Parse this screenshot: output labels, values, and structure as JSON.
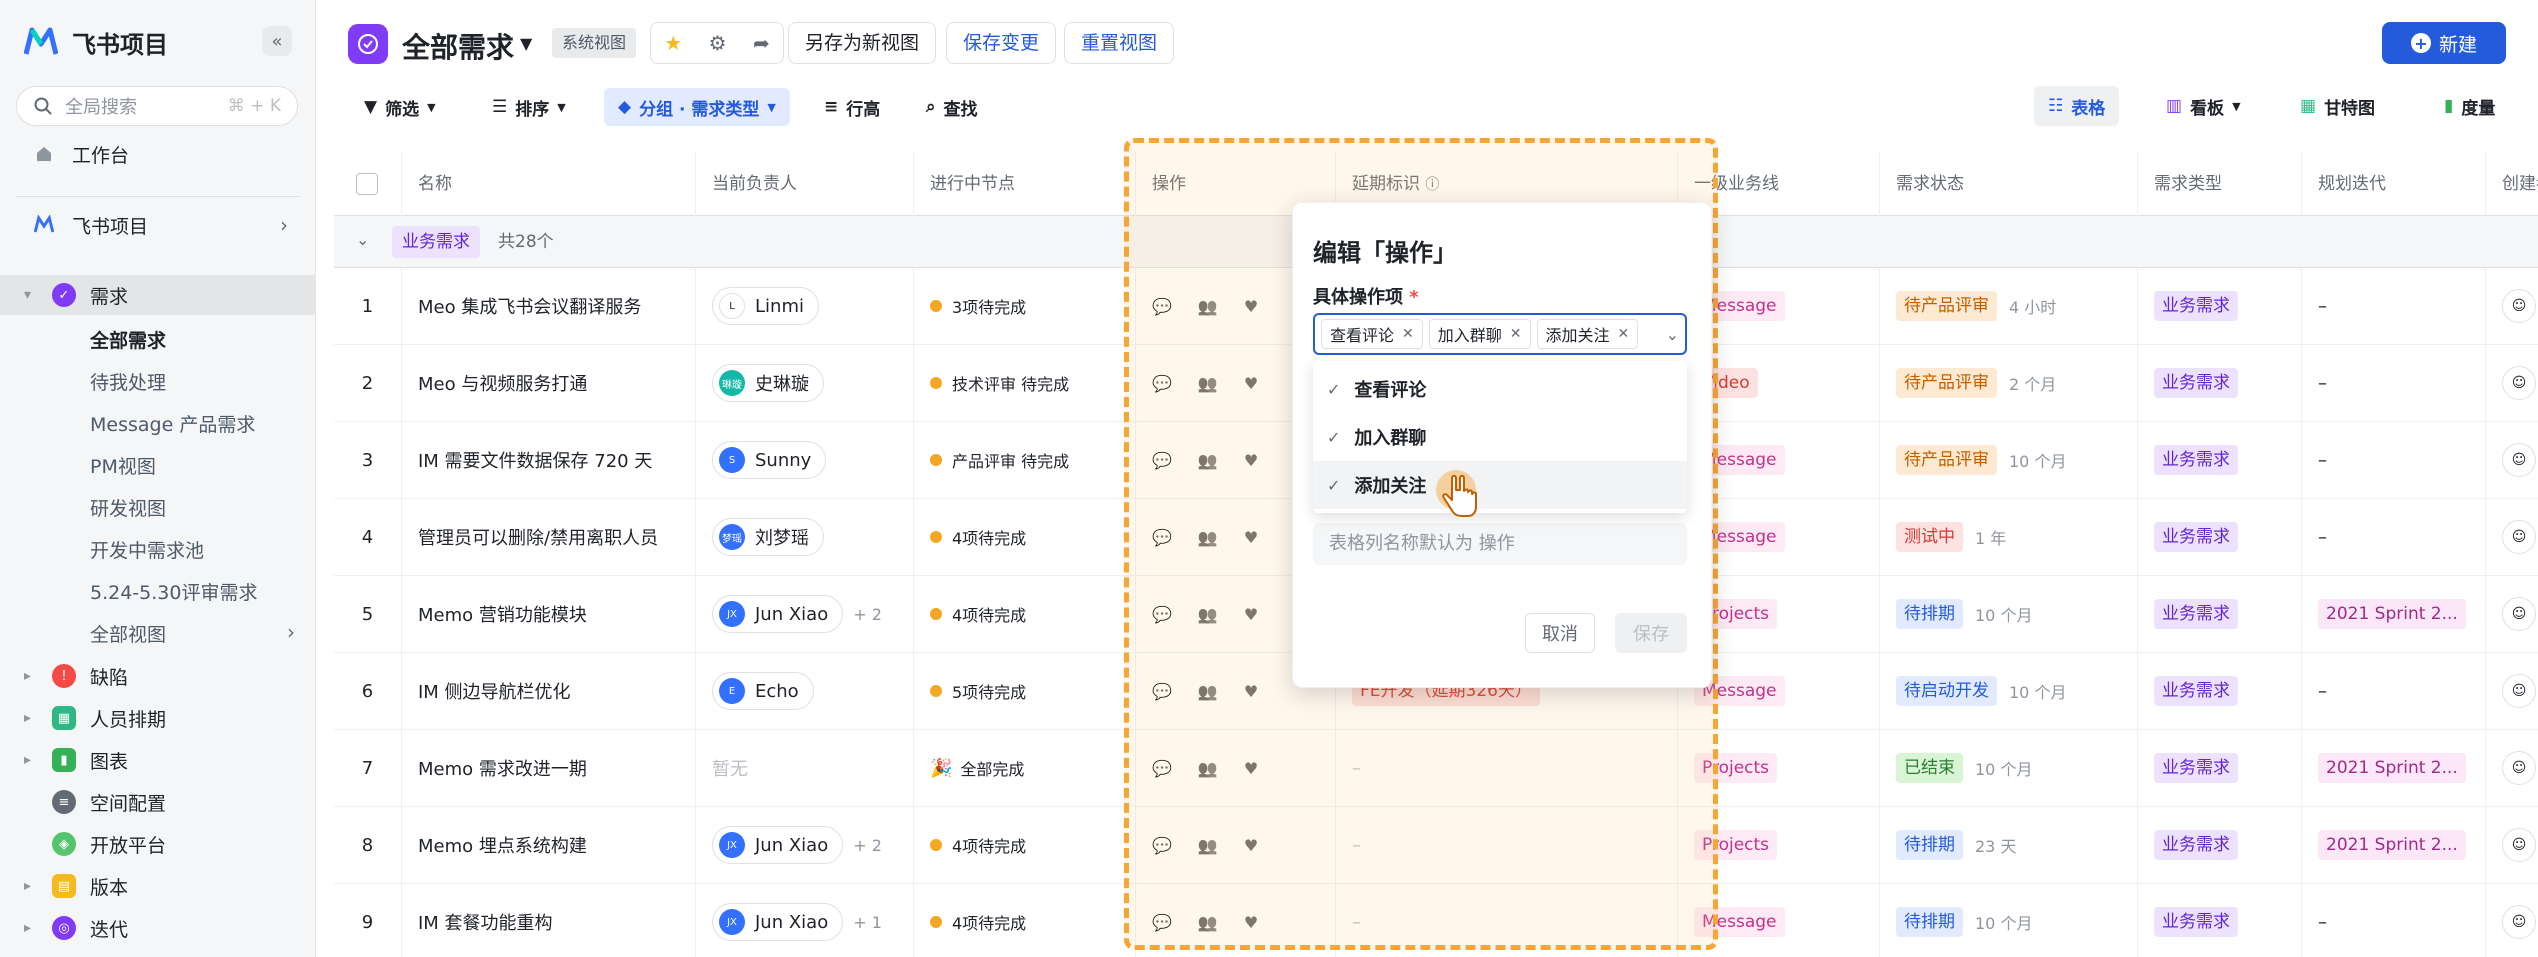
{
  "sidebar": {
    "brand": "飞书项目",
    "search_placeholder": "全局搜索",
    "search_shortcut": "⌘ + K",
    "workspace": "工作台",
    "project": "飞书项目",
    "sections": [
      {
        "label": "需求",
        "color": "#7f3bf5",
        "expanded": true
      },
      {
        "label": "缺陷",
        "color": "#f54a45"
      },
      {
        "label": "人员排期",
        "color": "#2eb885"
      },
      {
        "label": "图表",
        "color": "#34b057"
      },
      {
        "label": "空间配置",
        "color": "#646a73"
      },
      {
        "label": "开放平台",
        "color": "#56c36d"
      },
      {
        "label": "版本",
        "color": "#f7ba1e"
      },
      {
        "label": "迭代",
        "color": "#7f3bf5"
      }
    ],
    "sub_items": [
      "全部需求",
      "待我处理",
      "Message 产品需求",
      "PM视图",
      "研发视图",
      "开发中需求池",
      "5.24-5.30评审需求",
      "全部视图"
    ]
  },
  "header": {
    "title": "全部需求",
    "system_tag": "系统视图",
    "save_as_new": "另存为新视图",
    "save_changes": "保存变更",
    "reset_view": "重置视图",
    "new_button": "新建"
  },
  "toolbar": {
    "filter": "筛选",
    "sort": "排序",
    "group": "分组 · 需求类型",
    "row_height": "行高",
    "find": "查找"
  },
  "views": [
    "表格",
    "看板",
    "甘特图",
    "度量"
  ],
  "table": {
    "columns": [
      "名称",
      "当前负责人",
      "进行中节点",
      "操作",
      "延期标识",
      "一级业务线",
      "需求状态",
      "需求类型",
      "规划迭代",
      "创建者"
    ],
    "group": {
      "label": "业务需求",
      "count": "共28个"
    },
    "rows": [
      {
        "idx": "1",
        "name": "Meo 集成飞书会议翻译服务",
        "owner": "Linmi",
        "owner_extra": "",
        "avatar_color": "#ffffff",
        "avatar_text": "L",
        "node": "3项待完成",
        "node_kind": "dot",
        "line": "Message",
        "line_kind": "msg",
        "status": "待产品评审",
        "status_kind": "orange",
        "time": "4 小时",
        "type": "业务需求",
        "sprint": "–"
      },
      {
        "idx": "2",
        "name": "Meo 与视频服务打通",
        "owner": "史琳璇",
        "owner_extra": "",
        "avatar_color": "#14b8a6",
        "avatar_text": "琳璇",
        "node": "技术评审 待完成",
        "node_kind": "dot",
        "line": "Video",
        "line_kind": "vid",
        "status": "待产品评审",
        "status_kind": "orange",
        "time": "2 个月",
        "type": "业务需求",
        "sprint": "–"
      },
      {
        "idx": "3",
        "name": "IM 需要文件数据保存 720 天",
        "owner": "Sunny",
        "owner_extra": "",
        "avatar_color": "#3370ff",
        "avatar_text": "S",
        "node": "产品评审 待完成",
        "node_kind": "dot",
        "line": "Message",
        "line_kind": "msg",
        "status": "待产品评审",
        "status_kind": "orange",
        "time": "10 个月",
        "type": "业务需求",
        "sprint": "–"
      },
      {
        "idx": "4",
        "name": "管理员可以删除/禁用离职人员",
        "owner": "刘梦瑶",
        "owner_extra": "",
        "avatar_color": "#3370ff",
        "avatar_text": "梦瑶",
        "node": "4项待完成",
        "node_kind": "dot",
        "line": "Message",
        "line_kind": "msg",
        "status": "测试中",
        "status_kind": "red",
        "time": "1 年",
        "type": "业务需求",
        "sprint": "–"
      },
      {
        "idx": "5",
        "name": "Memo 营销功能模块",
        "owner": "Jun Xiao",
        "owner_extra": "+ 2",
        "avatar_color": "#3370ff",
        "avatar_text": "JX",
        "node": "4项待完成",
        "node_kind": "dot",
        "line": "Projects",
        "line_kind": "proj",
        "status": "待排期",
        "status_kind": "blue",
        "time": "10 个月",
        "type": "业务需求",
        "sprint": "2021 Sprint 2..."
      },
      {
        "idx": "6",
        "name": "IM 侧边导航栏优化",
        "owner": "Echo",
        "owner_extra": "",
        "avatar_color": "#3370ff",
        "avatar_text": "E",
        "node": "5项待完成",
        "node_kind": "dot",
        "line": "Message",
        "line_kind": "msg",
        "status": "待启动开发",
        "status_kind": "blue",
        "time": "10 个月",
        "type": "业务需求",
        "sprint": "–",
        "delay": "FE开发（延期326天）"
      },
      {
        "idx": "7",
        "name": "Memo 需求改进一期",
        "owner": "",
        "owner_extra": "",
        "owner_empty": "暂无",
        "node": "全部完成",
        "node_kind": "done",
        "line": "Projects",
        "line_kind": "proj",
        "status": "已结束",
        "status_kind": "green",
        "time": "10 个月",
        "type": "业务需求",
        "sprint": "2021 Sprint 2...",
        "delay": "–"
      },
      {
        "idx": "8",
        "name": "Memo 埋点系统构建",
        "owner": "Jun Xiao",
        "owner_extra": "+ 2",
        "avatar_color": "#3370ff",
        "avatar_text": "JX",
        "node": "4项待完成",
        "node_kind": "dot",
        "line": "Projects",
        "line_kind": "proj",
        "status": "待排期",
        "status_kind": "blue",
        "time": "23 天",
        "type": "业务需求",
        "sprint": "2021 Sprint 2...",
        "delay": "–"
      },
      {
        "idx": "9",
        "name": "IM 套餐功能重构",
        "owner": "Jun Xiao",
        "owner_extra": "+ 1",
        "avatar_color": "#3370ff",
        "avatar_text": "JX",
        "node": "4项待完成",
        "node_kind": "dot",
        "line": "Message",
        "line_kind": "msg",
        "status": "待排期",
        "status_kind": "blue",
        "time": "10 个月",
        "type": "业务需求",
        "sprint": "–",
        "delay": "–"
      }
    ]
  },
  "popover": {
    "title": "编辑「操作」",
    "field_label": "具体操作项",
    "required_mark": "*",
    "chips": [
      "查看评论",
      "加入群聊",
      "添加关注"
    ],
    "options": [
      "查看评论",
      "加入群聊",
      "添加关注"
    ],
    "name_placeholder": "表格列名称默认为 操作",
    "cancel": "取消",
    "save": "保存"
  }
}
